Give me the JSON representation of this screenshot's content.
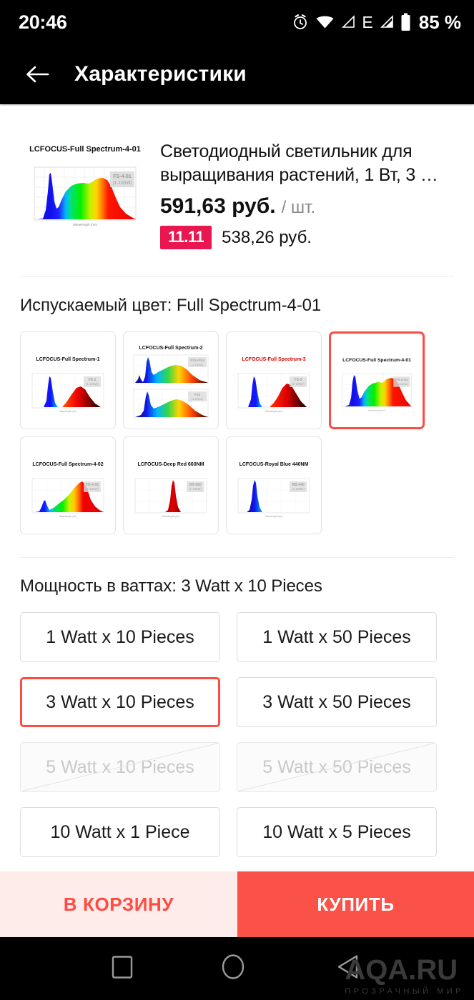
{
  "statusbar": {
    "time": "20:46",
    "battery_percent": "85 %",
    "network_type": "E",
    "icons": [
      "alarm-icon",
      "wifi-icon",
      "signal-empty-icon",
      "network-type-label",
      "signal-icon",
      "battery-icon"
    ]
  },
  "appbar": {
    "title": "Характеристики",
    "back_icon": "back-arrow-icon"
  },
  "product": {
    "title": "Светодиодный светильник для выращивания растений, 1 Вт, 3 …",
    "price": "591,63 руб.",
    "price_unit": "/ шт.",
    "promo_badge": "11.11",
    "promo_price": "538,26 руб.",
    "thumbnail_label": "LCFOCUS-Full Spectrum-4-01",
    "thumbnail_watermark_top": "FS-4-01",
    "thumbnail_watermark_bottom": "(1-100W)"
  },
  "color_section": {
    "title": "Испускаемый цвет: Full Spectrum-4-01",
    "selected": "Full Spectrum-4-01",
    "options": [
      {
        "label": "LCFOCUS-Full Spectrum-1",
        "kind": "blue-red",
        "selected": false
      },
      {
        "label": "LCFOCUS-Full Spectrum-2",
        "kind": "double-rainbow",
        "selected": false
      },
      {
        "label": "LCFOCUS-Full Spectrum-3",
        "kind": "blue-red-title-red",
        "selected": false
      },
      {
        "label": "LCFOCUS-Full Spectrum-4-01",
        "kind": "full-spectrum",
        "selected": true
      },
      {
        "label": "LCFOCUS-Full Spectrum-4-02",
        "kind": "full-spectrum-wide",
        "selected": false
      },
      {
        "label": "LCFOCUS-Deep Red 660NM",
        "kind": "deep-red",
        "selected": false
      },
      {
        "label": "LCFOCUS-Royal Blue 440NM",
        "kind": "royal-blue",
        "selected": false
      }
    ]
  },
  "watt_section": {
    "title": "Мощность в ваттах: 3 Watt x 10 Pieces",
    "selected": "3 Watt x 10 Pieces",
    "options": [
      {
        "label": "1 Watt x 10 Pieces",
        "selected": false,
        "disabled": false
      },
      {
        "label": "1 Watt x 50 Pieces",
        "selected": false,
        "disabled": false
      },
      {
        "label": "3 Watt x 10 Pieces",
        "selected": true,
        "disabled": false
      },
      {
        "label": "3 Watt x 50 Pieces",
        "selected": false,
        "disabled": false
      },
      {
        "label": "5 Watt x 10 Pieces",
        "selected": false,
        "disabled": true
      },
      {
        "label": "5 Watt x 50 Pieces",
        "selected": false,
        "disabled": true
      },
      {
        "label": "10 Watt x 1 Piece",
        "selected": false,
        "disabled": false
      },
      {
        "label": "10 Watt x 5 Pieces",
        "selected": false,
        "disabled": false
      }
    ]
  },
  "actionbar": {
    "cart_label": "В КОРЗИНУ",
    "buy_label": "КУПИТЬ",
    "cart_color": "#FF4B41",
    "buy_bg": "#FA5248"
  },
  "navbar": {
    "recent_icon": "square-recent-apps-icon",
    "home_icon": "circle-home-icon",
    "back_icon": "triangle-back-icon"
  },
  "watermark": {
    "main": "AQA.RU",
    "sub": "ПРОЗРАЧНЫЙ МИР"
  }
}
